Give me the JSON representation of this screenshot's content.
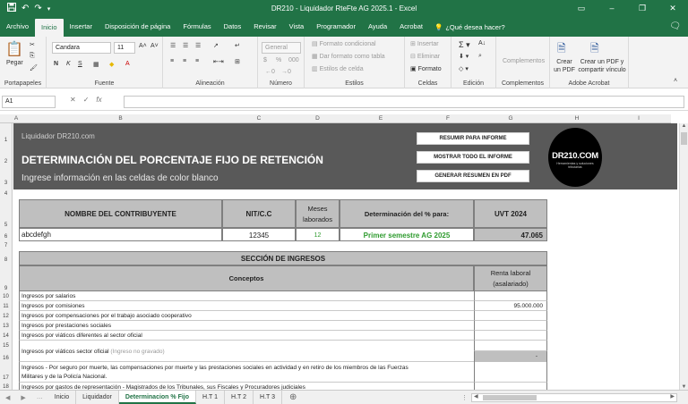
{
  "window": {
    "title": "DR210 - Liquidador RteFte AG 2025.1  -  Excel"
  },
  "quick_access": {
    "save": "save-icon",
    "undo": "undo-icon",
    "redo": "redo-icon"
  },
  "window_controls": {
    "minimize": "–",
    "restore": "❐",
    "close": "✕"
  },
  "tabs": [
    "Archivo",
    "Inicio",
    "Insertar",
    "Disposición de página",
    "Fórmulas",
    "Datos",
    "Revisar",
    "Vista",
    "Programador",
    "Ayuda",
    "Acrobat"
  ],
  "tell_me": "¿Qué desea hacer?",
  "ribbon": {
    "portapapeles": {
      "label": "Portapapeles",
      "paste": "Pegar"
    },
    "fuente": {
      "label": "Fuente",
      "font": "Candara",
      "size": "11",
      "bold": "N",
      "italic": "K",
      "underline": "S"
    },
    "alineacion": {
      "label": "Alineación"
    },
    "numero": {
      "label": "Número",
      "format": "General",
      "currency": "$",
      "percent": "%"
    },
    "estilos": {
      "label": "Estilos",
      "cond": "Formato condicional",
      "table": "Dar formato como tabla",
      "cell": "Estilos de celda"
    },
    "celdas": {
      "label": "Celdas",
      "insert": "Insertar",
      "delete": "Eliminar",
      "format": "Formato"
    },
    "edicion": {
      "label": "Edición"
    },
    "complementos": {
      "label": "Complementos",
      "btn": "Complementos"
    },
    "acrobat": {
      "label": "Adobe Acrobat",
      "create": "Crear un PDF",
      "share": "Crear un PDF y compartir vínculo"
    }
  },
  "formula_bar": {
    "name_box": "A1",
    "cancel": "✕",
    "enter": "✓",
    "fx": "fx"
  },
  "columns": [
    "A",
    "B",
    "C",
    "D",
    "E",
    "F",
    "G",
    "H",
    "I"
  ],
  "rows": [
    "1",
    "2",
    "3",
    "4",
    "5",
    "6",
    "7",
    "8",
    "9",
    "10",
    "11",
    "12",
    "13",
    "14",
    "15",
    "16",
    "17",
    "18"
  ],
  "banner": {
    "brand": "Liquidador DR210.com",
    "heading": "DETERMINACIÓN DEL PORCENTAJE FIJO DE RETENCIÓN",
    "subheading": "Ingrese información en las celdas de color blanco",
    "btn_summary": "RESUMIR PARA INFORME",
    "btn_show_all": "MOSTRAR TODO EL INFORME",
    "btn_pdf": "GENERAR RESUMEN EN PDF",
    "logo_text": "DR210.COM",
    "logo_tagline": "Herramientas y soluciones tributarias"
  },
  "taxpayer": {
    "h_name": "NOMBRE DEL CONTRIBUYENTE",
    "h_nit": "NIT/C.C",
    "h_months": "Meses laborados",
    "h_det": "Determinación del % para:",
    "h_uvt": "UVT 2024",
    "name": "abcdefgh",
    "nit": "12345",
    "months": "12",
    "det": "Primer semestre AG 2025",
    "uvt": "47.065"
  },
  "income": {
    "title": "SECCIÓN DE INGRESOS",
    "col_concepts": "Conceptos",
    "col_renta": "Renta laboral (asalariado)",
    "items": [
      {
        "concept": "Ingresos por salarios",
        "value": ""
      },
      {
        "concept": "Ingresos por comisiones",
        "value": "95.000.000"
      },
      {
        "concept": "Ingresos por compensaciones por el trabajo asociado cooperativo",
        "value": ""
      },
      {
        "concept": "Ingresos por prestaciones sociales",
        "value": ""
      },
      {
        "concept": "Ingresos por viáticos diferentes al sector oficial",
        "value": ""
      }
    ],
    "viaticos_oficial": "Ingresos por viáticos sector oficial",
    "viaticos_note": "(Ingreso no gravado)",
    "dash": "-",
    "seguro_line1": "Ingresos - Por seguro por muerte, las compensaciones por muerte y las prestaciones sociales en actividad y en retiro de los miembros de las Fuerzas",
    "seguro_line2": "Militares y de la Policía Nacional.",
    "row18_text": "Ingresos por gastos de representación - Magistrados de los Tribunales, sus Fiscales y Procuradores judiciales"
  },
  "sheet_tabs": [
    "Inicio",
    "Liquidador",
    "Determinacion % Fijo",
    "H.T 1",
    "H.T 2",
    "H.T 3"
  ],
  "active_sheet": "Determinacion % Fijo",
  "colors": {
    "excel_green": "#217346",
    "banner": "#595959",
    "header_gray": "#bfbfbf",
    "green_text": "#2e9b2e"
  }
}
